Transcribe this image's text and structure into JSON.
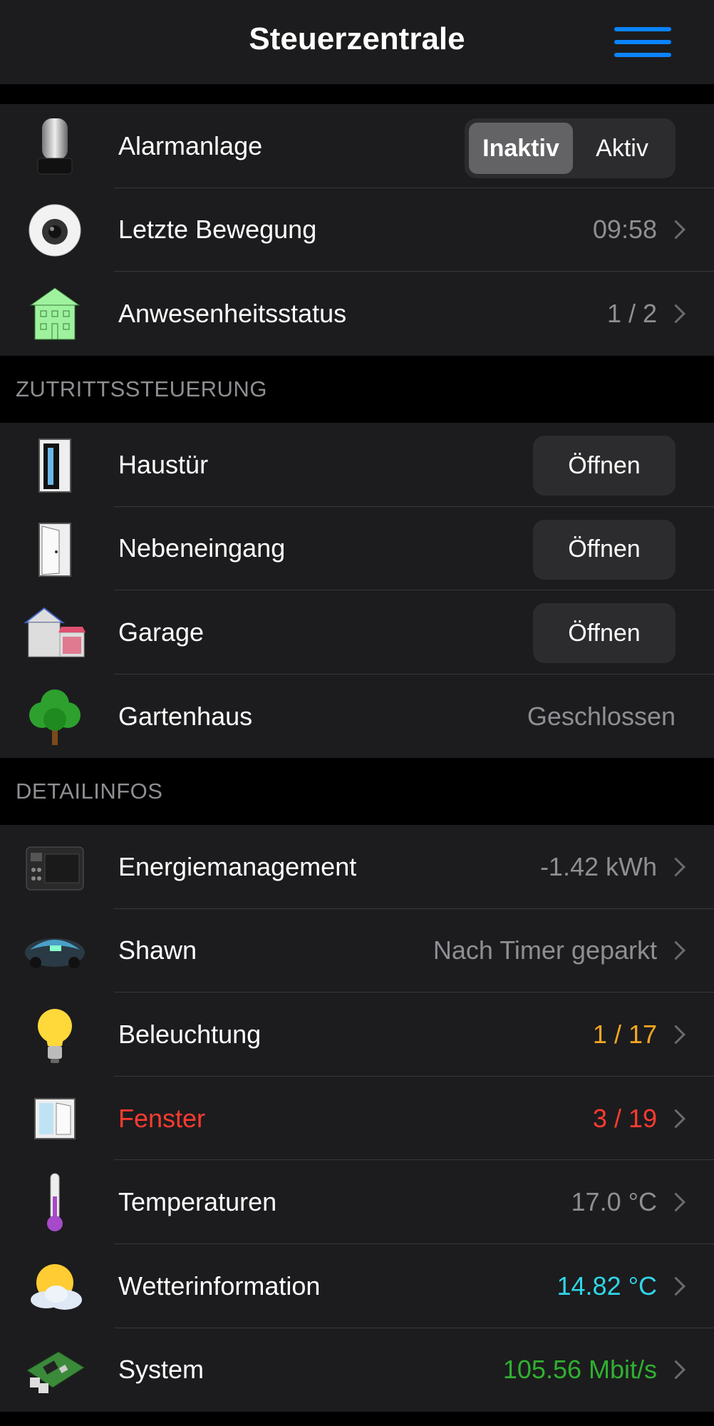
{
  "header": {
    "title": "Steuerzentrale",
    "menu_icon": "hamburger-menu-icon",
    "accent": "#0a84ff"
  },
  "security": {
    "rows": [
      {
        "label": "Alarmanlage",
        "segments": [
          "Inaktiv",
          "Aktiv"
        ],
        "selected": "Inaktiv",
        "icon": "siren-icon"
      },
      {
        "label": "Letzte Bewegung",
        "value": "09:58",
        "icon": "camera-icon"
      },
      {
        "label": "Anwesenheitsstatus",
        "value": "1 / 2",
        "icon": "house-icon"
      }
    ]
  },
  "access": {
    "header": "ZUTRITTSSTEUERUNG",
    "rows": [
      {
        "label": "Haustür",
        "button": "Öffnen",
        "icon": "front-door-icon"
      },
      {
        "label": "Nebeneingang",
        "button": "Öffnen",
        "icon": "side-door-icon"
      },
      {
        "label": "Garage",
        "button": "Öffnen",
        "icon": "garage-icon"
      },
      {
        "label": "Gartenhaus",
        "value": "Geschlossen",
        "icon": "tree-icon"
      }
    ]
  },
  "details": {
    "header": "DETAILINFOS",
    "rows": [
      {
        "label": "Energiemanagement",
        "value": "-1.42 kWh",
        "icon": "power-station-icon"
      },
      {
        "label": "Shawn",
        "value": "Nach Timer geparkt",
        "icon": "robot-mower-icon"
      },
      {
        "label": "Beleuchtung",
        "value": "1 / 17",
        "value_color": "#f5a623",
        "icon": "light-bulb-icon"
      },
      {
        "label": "Fenster",
        "value": "3 / 19",
        "label_color": "#ff3b30",
        "value_color": "#ff3b30",
        "icon": "window-icon"
      },
      {
        "label": "Temperaturen",
        "value": "17.0 °C",
        "icon": "thermometer-icon"
      },
      {
        "label": "Wetterinformation",
        "value": "14.82 °C",
        "value_color": "#30d5e8",
        "icon": "sun-cloud-icon"
      },
      {
        "label": "System",
        "value": "105.56 Mbit/s",
        "value_color": "#30b030",
        "icon": "circuit-board-icon"
      }
    ]
  }
}
